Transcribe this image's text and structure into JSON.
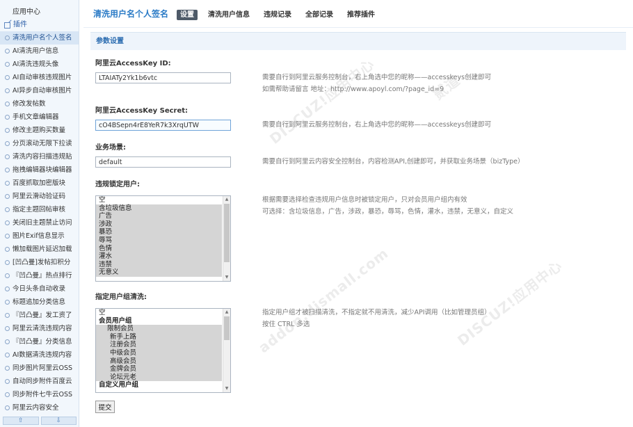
{
  "sidebar": {
    "app_center": "应用中心",
    "plugins_group": "插件",
    "items": [
      {
        "label": "清洗用户名个人签名",
        "active": true
      },
      {
        "label": "AI清洗用户信息"
      },
      {
        "label": "AI清洗违规头像"
      },
      {
        "label": "AI自动审核违规图片"
      },
      {
        "label": "AI异步自动审核图片"
      },
      {
        "label": "修改发帖数"
      },
      {
        "label": "手机文章编辑器"
      },
      {
        "label": "修改主题购买数量"
      },
      {
        "label": "分页滚动无限下拉读"
      },
      {
        "label": "清洗内容扫描违规贴"
      },
      {
        "label": "拖拽编辑器块编辑器"
      },
      {
        "label": "百度抓取加密版块"
      },
      {
        "label": "阿里云滑动验证码"
      },
      {
        "label": "指定主题回帖审核"
      },
      {
        "label": "关闭旧主题禁止访问"
      },
      {
        "label": "图片Exif信息显示"
      },
      {
        "label": "懒加载图片延迟加载"
      },
      {
        "label": "[凹凸曼]发帖扣积分"
      },
      {
        "label": "『凹凸曼』热点排行"
      },
      {
        "label": "今日头条自动收录"
      },
      {
        "label": "标题追加分类信息"
      },
      {
        "label": "『凹凸曼』发工资了"
      },
      {
        "label": "阿里云清洗违规内容"
      },
      {
        "label": "『凹凸曼』分类信息"
      },
      {
        "label": "AI数据清洗违规内容"
      },
      {
        "label": "同步图片阿里云OSS"
      },
      {
        "label": "自动同步附件百度云"
      },
      {
        "label": "同步附件七牛云OSS"
      },
      {
        "label": "阿里云内容安全"
      }
    ],
    "pager_up": "⇧",
    "pager_down": "⇩"
  },
  "header": {
    "title": "清洗用户名个人签名",
    "tabs": [
      {
        "label": "设置",
        "active": true
      },
      {
        "label": "清洗用户信息"
      },
      {
        "label": "违规记录"
      },
      {
        "label": "全部记录"
      },
      {
        "label": "推荐插件"
      }
    ]
  },
  "section_title": "参数设置",
  "fields": {
    "access_key_id": {
      "label": "阿里云AccessKey ID:",
      "value": "LTAIATy2Yk1b6vtc",
      "hint1": "需要自行到阿里云服务控制台，右上角选中您的昵称——accesskeys创建即可",
      "hint2": "如需帮助请留言 地址：http://www.apoyl.com/?page_id=9"
    },
    "access_key_secret": {
      "label": "阿里云AccessKey Secret:",
      "value": "cO4BSepn4rE8YeR7k3XrqUTW",
      "hint": "需要自行到阿里云服务控制台，右上角选中您的昵称——accesskeys创建即可"
    },
    "business_scene": {
      "label": "业务场景:",
      "value": "default",
      "hint": "需要自行到阿里云内容安全控制台，内容检测API,创建即可，并获取业务场景（bizType）"
    },
    "lock_users": {
      "label": "违规锁定用户:",
      "options": [
        {
          "label": "空",
          "selected": false
        },
        {
          "label": "含垃圾信息",
          "selected": true
        },
        {
          "label": "广告",
          "selected": true
        },
        {
          "label": "涉政",
          "selected": true
        },
        {
          "label": "暴恐",
          "selected": true
        },
        {
          "label": "辱骂",
          "selected": true
        },
        {
          "label": "色情",
          "selected": true
        },
        {
          "label": "灌水",
          "selected": true
        },
        {
          "label": "违禁",
          "selected": true
        },
        {
          "label": "无意义",
          "selected": true
        }
      ],
      "hint1": "根据需要选择检查违规用户信息时被锁定用户，只对会员用户组内有效",
      "hint2": "可选择：含垃圾信息，广告，涉政，暴恐，辱骂，色情，灌水，违禁，无意义，自定义"
    },
    "user_groups": {
      "label": "指定用户组清洗:",
      "options": [
        {
          "label": "空",
          "selected": false,
          "kind": "plain"
        },
        {
          "label": "会员用户组",
          "selected": false,
          "kind": "group"
        },
        {
          "label": "限制会员",
          "selected": true,
          "kind": "indent"
        },
        {
          "label": "新手上路",
          "selected": true,
          "kind": "indent2"
        },
        {
          "label": "注册会员",
          "selected": true,
          "kind": "indent2"
        },
        {
          "label": "中级会员",
          "selected": true,
          "kind": "indent2"
        },
        {
          "label": "高级会员",
          "selected": true,
          "kind": "indent2"
        },
        {
          "label": "金牌会员",
          "selected": true,
          "kind": "indent2"
        },
        {
          "label": "论坛元老",
          "selected": true,
          "kind": "indent2"
        },
        {
          "label": "自定义用户组",
          "selected": false,
          "kind": "group"
        }
      ],
      "hint1": "指定用户组才被扫描清洗，不指定就不用清洗，减少API调用（比如管理员组）",
      "hint2": "按住 CTRL 多选"
    }
  },
  "submit_label": "提交",
  "watermark": {
    "line1": "DISCUZ!应用中心",
    "line2": "addon.dismall.com",
    "mark": "贰道"
  }
}
